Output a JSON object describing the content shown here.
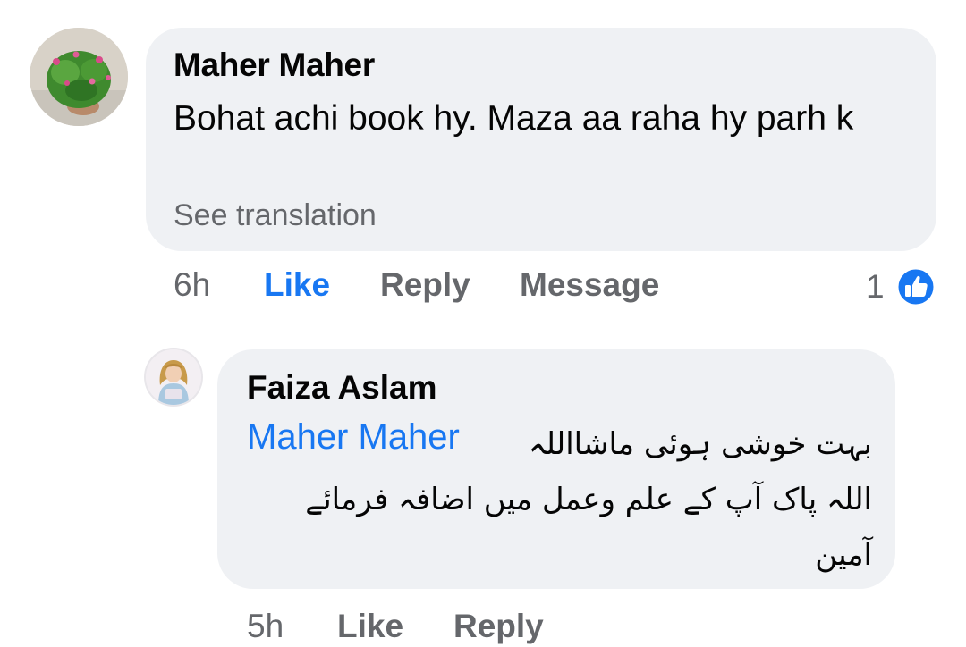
{
  "comment": {
    "author": "Maher Maher",
    "text": "Bohat achi book hy. Maza aa raha hy parh k",
    "see_translation": "See translation",
    "time": "6h",
    "like_label": "Like",
    "reply_label": "Reply",
    "message_label": "Message",
    "reaction_count": "1",
    "reaction_icon": "thumbs-up-icon",
    "like_color": "#1877f2"
  },
  "reply": {
    "author": "Faiza Aslam",
    "mention": "Maher Maher",
    "text_line1": "بہت خوشی ہوئی ماشااللہ",
    "text_line2": "اللہ پاک آپ کے علم وعمل میں اضافہ فرمائے",
    "text_line3": "آمین",
    "time": "5h",
    "like_label": "Like",
    "reply_label": "Reply"
  },
  "colors": {
    "bubble": "#eff1f4",
    "accent": "#1877f2",
    "secondary_text": "#65676b",
    "primary_text": "#050505"
  }
}
